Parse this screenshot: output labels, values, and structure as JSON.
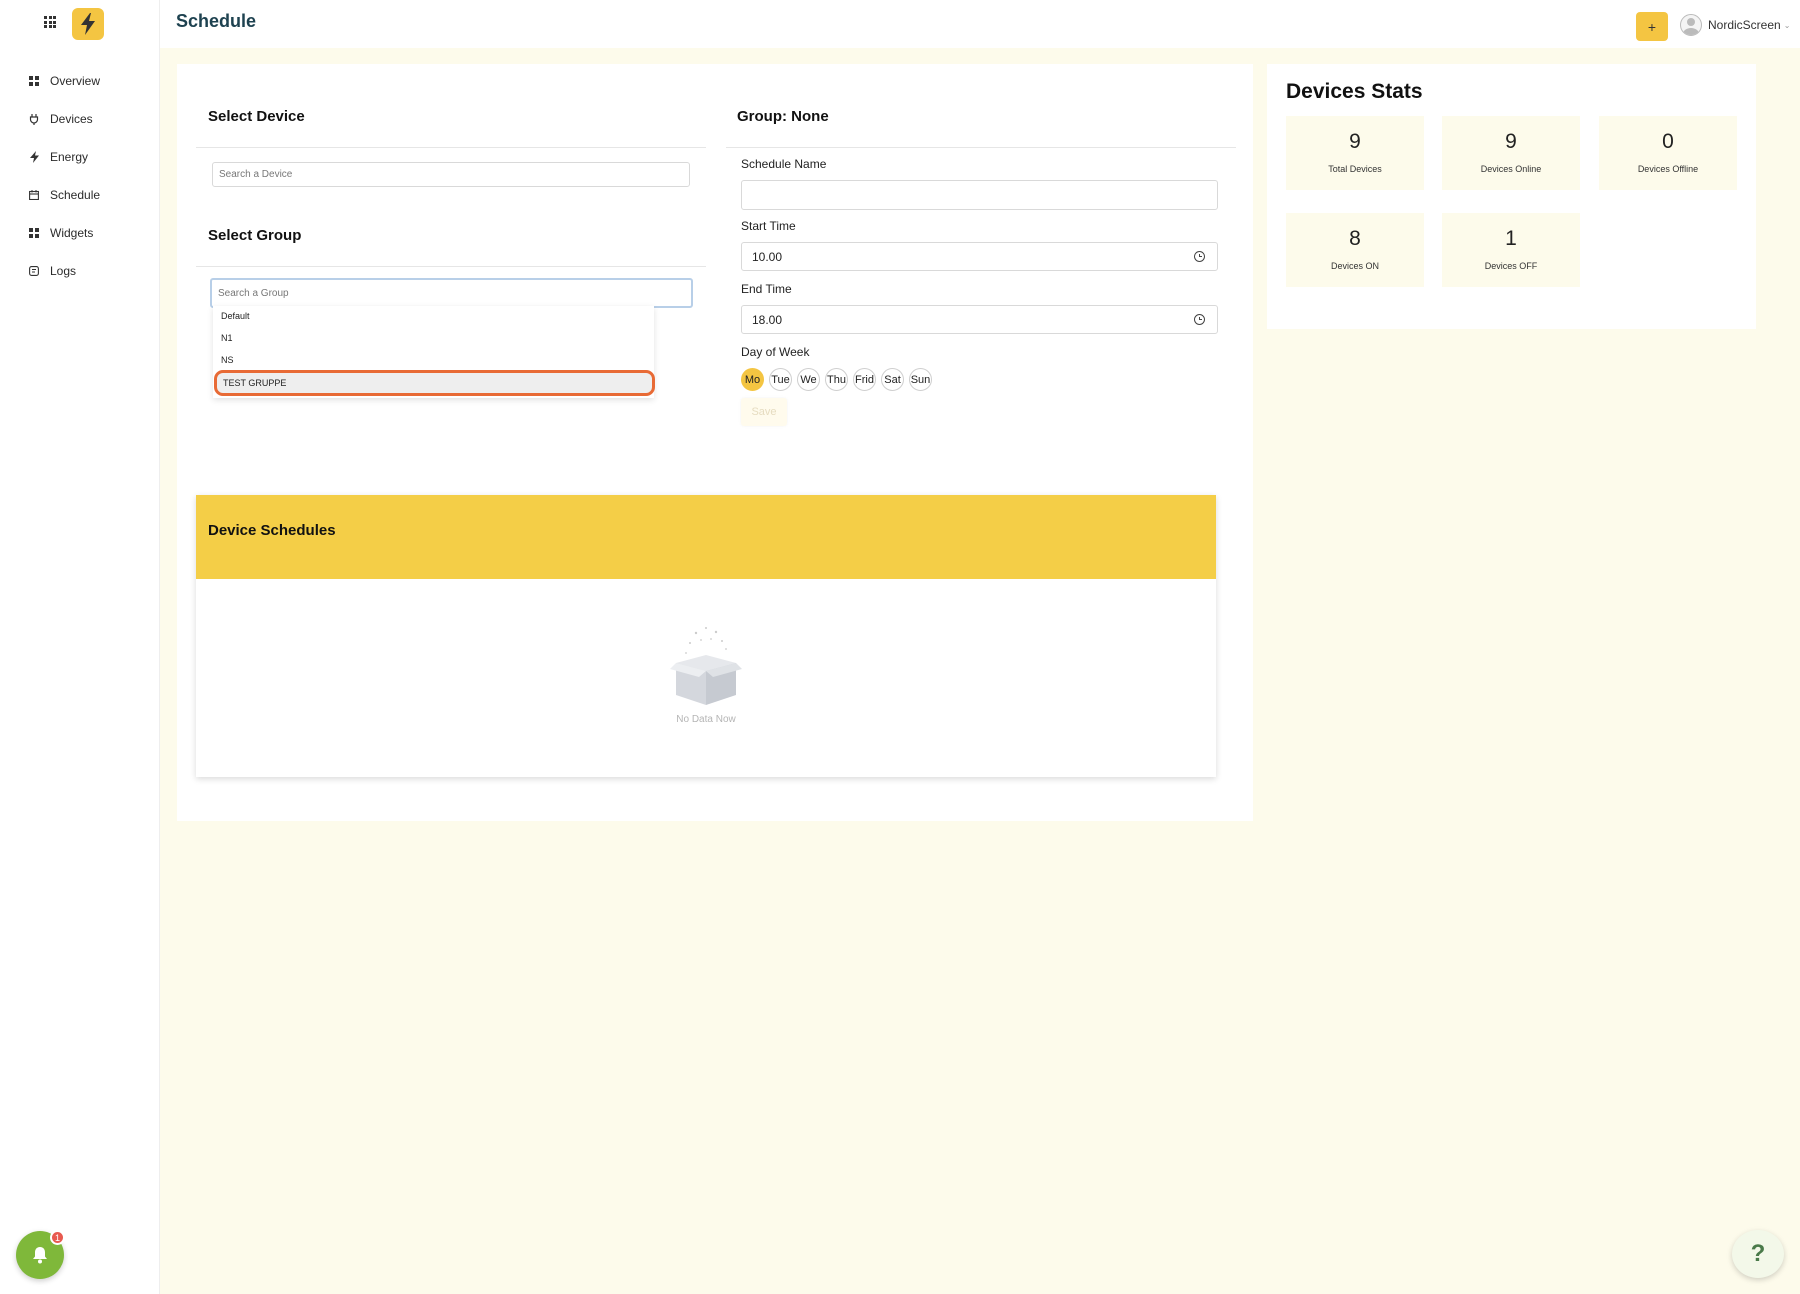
{
  "header": {
    "title": "Schedule",
    "add_label": "+",
    "username": "NordicScreen",
    "caret": "⌄"
  },
  "sidebar": {
    "items": [
      {
        "label": "Overview",
        "icon": "grid-icon"
      },
      {
        "label": "Devices",
        "icon": "plug-icon"
      },
      {
        "label": "Energy",
        "icon": "bolt-icon"
      },
      {
        "label": "Schedule",
        "icon": "calendar-icon"
      },
      {
        "label": "Widgets",
        "icon": "grid-icon"
      },
      {
        "label": "Logs",
        "icon": "log-icon"
      }
    ],
    "notification_count": "1"
  },
  "device": {
    "title": "Select Device",
    "search_placeholder": "Search a Device"
  },
  "group": {
    "title": "Select Group",
    "search_placeholder": "Search a Group",
    "options": [
      "Default",
      "N1",
      "NS",
      "TEST GRUPPE"
    ],
    "highlighted": "TEST GRUPPE"
  },
  "form": {
    "group_heading": "Group: None",
    "schedule_name_label": "Schedule Name",
    "schedule_name_value": "",
    "start_time_label": "Start Time",
    "start_time_value": "10.00",
    "end_time_label": "End Time",
    "end_time_value": "18.00",
    "day_of_week_label": "Day of Week",
    "days": [
      "Mo",
      "Tue",
      "We",
      "Thu",
      "Frid",
      "Sat",
      "Sun"
    ],
    "selected_day": "Mo",
    "save_label": "Save"
  },
  "schedules": {
    "title": "Device Schedules",
    "empty_text": "No Data Now"
  },
  "stats": {
    "title": "Devices Stats",
    "cards": [
      {
        "value": "9",
        "label": "Total Devices"
      },
      {
        "value": "9",
        "label": "Devices Online"
      },
      {
        "value": "0",
        "label": "Devices Offline"
      },
      {
        "value": "8",
        "label": "Devices ON"
      },
      {
        "value": "1",
        "label": "Devices OFF"
      }
    ]
  },
  "help_label": "?",
  "colors": {
    "accent": "#f4c542",
    "background": "#fdfbeb",
    "title": "#1e4250",
    "highlight_border": "#e86a35",
    "bell": "#7fb83a"
  }
}
